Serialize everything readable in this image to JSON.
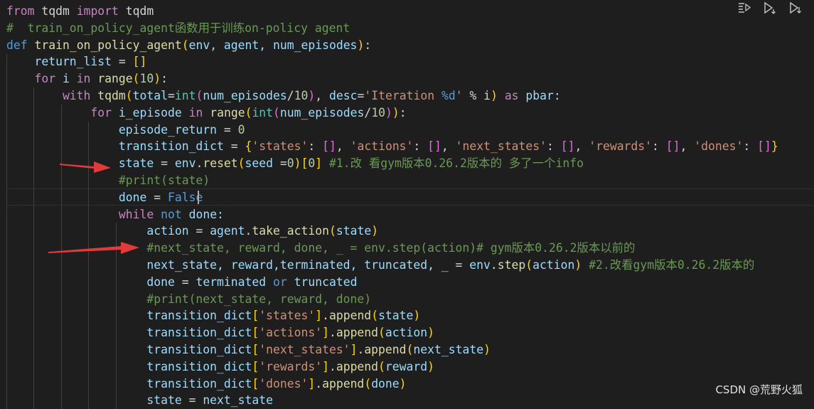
{
  "code_lines": [
    [
      {
        "t": "from",
        "c": "#c586c0"
      },
      {
        "t": " tqdm ",
        "c": "#d4d4d4"
      },
      {
        "t": "import",
        "c": "#c586c0"
      },
      {
        "t": " tqdm",
        "c": "#d4d4d4"
      }
    ],
    [
      {
        "t": "#  train_on_policy_agent函数用于训练on-policy agent",
        "c": "#6a9955"
      }
    ],
    [
      {
        "t": "def",
        "c": "#569cd6"
      },
      {
        "t": " ",
        "c": "#d4d4d4"
      },
      {
        "t": "train_on_policy_agent",
        "c": "#dcdcaa"
      },
      {
        "t": "(",
        "c": "#ffd700"
      },
      {
        "t": "env, agent, num_episodes",
        "c": "#9cdcfe"
      },
      {
        "t": ")",
        "c": "#ffd700"
      },
      {
        "t": ":",
        "c": "#d4d4d4"
      }
    ],
    [
      {
        "t": "    return_list",
        "c": "#9cdcfe"
      },
      {
        "t": " = ",
        "c": "#d4d4d4"
      },
      {
        "t": "[]",
        "c": "#ffd700"
      }
    ],
    [
      {
        "t": "    for",
        "c": "#c586c0"
      },
      {
        "t": " i ",
        "c": "#9cdcfe"
      },
      {
        "t": "in",
        "c": "#c586c0"
      },
      {
        "t": " ",
        "c": "#d4d4d4"
      },
      {
        "t": "range",
        "c": "#dcdcaa"
      },
      {
        "t": "(",
        "c": "#ffd700"
      },
      {
        "t": "10",
        "c": "#b5cea8"
      },
      {
        "t": ")",
        "c": "#ffd700"
      },
      {
        "t": ":",
        "c": "#d4d4d4"
      }
    ],
    [
      {
        "t": "        with",
        "c": "#c586c0"
      },
      {
        "t": " ",
        "c": "#d4d4d4"
      },
      {
        "t": "tqdm",
        "c": "#dcdcaa"
      },
      {
        "t": "(",
        "c": "#ffd700"
      },
      {
        "t": "total",
        "c": "#9cdcfe"
      },
      {
        "t": "=",
        "c": "#d4d4d4"
      },
      {
        "t": "int",
        "c": "#4ec9b0"
      },
      {
        "t": "(",
        "c": "#da70d6"
      },
      {
        "t": "num_episodes",
        "c": "#9cdcfe"
      },
      {
        "t": "/",
        "c": "#d4d4d4"
      },
      {
        "t": "10",
        "c": "#b5cea8"
      },
      {
        "t": ")",
        "c": "#da70d6"
      },
      {
        "t": ", ",
        "c": "#d4d4d4"
      },
      {
        "t": "desc",
        "c": "#9cdcfe"
      },
      {
        "t": "=",
        "c": "#d4d4d4"
      },
      {
        "t": "'Iteration ",
        "c": "#ce9178"
      },
      {
        "t": "%d",
        "c": "#569cd6"
      },
      {
        "t": "'",
        "c": "#ce9178"
      },
      {
        "t": " % i",
        "c": "#d4d4d4"
      },
      {
        "t": ")",
        "c": "#ffd700"
      },
      {
        "t": " ",
        "c": "#d4d4d4"
      },
      {
        "t": "as",
        "c": "#c586c0"
      },
      {
        "t": " pbar:",
        "c": "#9cdcfe"
      }
    ],
    [
      {
        "t": "            for",
        "c": "#c586c0"
      },
      {
        "t": " i_episode ",
        "c": "#9cdcfe"
      },
      {
        "t": "in",
        "c": "#c586c0"
      },
      {
        "t": " ",
        "c": "#d4d4d4"
      },
      {
        "t": "range",
        "c": "#dcdcaa"
      },
      {
        "t": "(",
        "c": "#ffd700"
      },
      {
        "t": "int",
        "c": "#4ec9b0"
      },
      {
        "t": "(",
        "c": "#da70d6"
      },
      {
        "t": "num_episodes",
        "c": "#9cdcfe"
      },
      {
        "t": "/",
        "c": "#d4d4d4"
      },
      {
        "t": "10",
        "c": "#b5cea8"
      },
      {
        "t": ")",
        "c": "#da70d6"
      },
      {
        "t": ")",
        "c": "#ffd700"
      },
      {
        "t": ":",
        "c": "#d4d4d4"
      }
    ],
    [
      {
        "t": "                episode_return",
        "c": "#9cdcfe"
      },
      {
        "t": " = ",
        "c": "#d4d4d4"
      },
      {
        "t": "0",
        "c": "#b5cea8"
      }
    ],
    [
      {
        "t": "                transition_dict",
        "c": "#9cdcfe"
      },
      {
        "t": " = ",
        "c": "#d4d4d4"
      },
      {
        "t": "{",
        "c": "#ffd700"
      },
      {
        "t": "'states'",
        "c": "#ce9178"
      },
      {
        "t": ": ",
        "c": "#d4d4d4"
      },
      {
        "t": "[]",
        "c": "#da70d6"
      },
      {
        "t": ", ",
        "c": "#d4d4d4"
      },
      {
        "t": "'actions'",
        "c": "#ce9178"
      },
      {
        "t": ": ",
        "c": "#d4d4d4"
      },
      {
        "t": "[]",
        "c": "#da70d6"
      },
      {
        "t": ", ",
        "c": "#d4d4d4"
      },
      {
        "t": "'next_states'",
        "c": "#ce9178"
      },
      {
        "t": ": ",
        "c": "#d4d4d4"
      },
      {
        "t": "[]",
        "c": "#da70d6"
      },
      {
        "t": ", ",
        "c": "#d4d4d4"
      },
      {
        "t": "'rewards'",
        "c": "#ce9178"
      },
      {
        "t": ": ",
        "c": "#d4d4d4"
      },
      {
        "t": "[]",
        "c": "#da70d6"
      },
      {
        "t": ", ",
        "c": "#d4d4d4"
      },
      {
        "t": "'dones'",
        "c": "#ce9178"
      },
      {
        "t": ": ",
        "c": "#d4d4d4"
      },
      {
        "t": "[]",
        "c": "#da70d6"
      },
      {
        "t": "}",
        "c": "#ffd700"
      }
    ],
    [
      {
        "t": "                state",
        "c": "#9cdcfe"
      },
      {
        "t": " = ",
        "c": "#d4d4d4"
      },
      {
        "t": "env",
        "c": "#9cdcfe"
      },
      {
        "t": ".",
        "c": "#d4d4d4"
      },
      {
        "t": "reset",
        "c": "#dcdcaa"
      },
      {
        "t": "(",
        "c": "#ffd700"
      },
      {
        "t": "seed",
        "c": "#9cdcfe"
      },
      {
        "t": " =",
        "c": "#d4d4d4"
      },
      {
        "t": "0",
        "c": "#b5cea8"
      },
      {
        "t": ")",
        "c": "#ffd700"
      },
      {
        "t": "[",
        "c": "#ffd700"
      },
      {
        "t": "0",
        "c": "#b5cea8"
      },
      {
        "t": "]",
        "c": "#ffd700"
      },
      {
        "t": " #1.改 看gym版本0.26.2版本的 多了一个info",
        "c": "#6a9955"
      }
    ],
    [
      {
        "t": "                #print(state)",
        "c": "#6a9955"
      }
    ],
    [
      {
        "t": "                done",
        "c": "#9cdcfe"
      },
      {
        "t": " = ",
        "c": "#d4d4d4"
      },
      {
        "t": "False",
        "c": "#569cd6"
      }
    ],
    [
      {
        "t": "                while",
        "c": "#c586c0"
      },
      {
        "t": " ",
        "c": "#d4d4d4"
      },
      {
        "t": "not",
        "c": "#569cd6"
      },
      {
        "t": " done:",
        "c": "#9cdcfe"
      }
    ],
    [
      {
        "t": "                    action",
        "c": "#9cdcfe"
      },
      {
        "t": " = ",
        "c": "#d4d4d4"
      },
      {
        "t": "agent",
        "c": "#9cdcfe"
      },
      {
        "t": ".",
        "c": "#d4d4d4"
      },
      {
        "t": "take_action",
        "c": "#dcdcaa"
      },
      {
        "t": "(",
        "c": "#ffd700"
      },
      {
        "t": "state",
        "c": "#9cdcfe"
      },
      {
        "t": ")",
        "c": "#ffd700"
      }
    ],
    [
      {
        "t": "                    #next_state, reward, done, _ = env.step(action)# gym版本0.26.2版本以前的",
        "c": "#6a9955"
      }
    ],
    [
      {
        "t": "                    next_state, reward,terminated, truncated, _",
        "c": "#9cdcfe"
      },
      {
        "t": " = ",
        "c": "#d4d4d4"
      },
      {
        "t": "env",
        "c": "#9cdcfe"
      },
      {
        "t": ".",
        "c": "#d4d4d4"
      },
      {
        "t": "step",
        "c": "#dcdcaa"
      },
      {
        "t": "(",
        "c": "#ffd700"
      },
      {
        "t": "action",
        "c": "#9cdcfe"
      },
      {
        "t": ")",
        "c": "#ffd700"
      },
      {
        "t": " #2.改看gym版本0.26.2版本的",
        "c": "#6a9955"
      }
    ],
    [
      {
        "t": "                    done",
        "c": "#9cdcfe"
      },
      {
        "t": " = ",
        "c": "#d4d4d4"
      },
      {
        "t": "terminated ",
        "c": "#9cdcfe"
      },
      {
        "t": "or",
        "c": "#569cd6"
      },
      {
        "t": " truncated",
        "c": "#9cdcfe"
      }
    ],
    [
      {
        "t": "                    #print(next_state, reward, done)",
        "c": "#6a9955"
      }
    ],
    [
      {
        "t": "                    transition_dict",
        "c": "#9cdcfe"
      },
      {
        "t": "[",
        "c": "#ffd700"
      },
      {
        "t": "'states'",
        "c": "#ce9178"
      },
      {
        "t": "]",
        "c": "#ffd700"
      },
      {
        "t": ".",
        "c": "#d4d4d4"
      },
      {
        "t": "append",
        "c": "#dcdcaa"
      },
      {
        "t": "(",
        "c": "#ffd700"
      },
      {
        "t": "state",
        "c": "#9cdcfe"
      },
      {
        "t": ")",
        "c": "#ffd700"
      }
    ],
    [
      {
        "t": "                    transition_dict",
        "c": "#9cdcfe"
      },
      {
        "t": "[",
        "c": "#ffd700"
      },
      {
        "t": "'actions'",
        "c": "#ce9178"
      },
      {
        "t": "]",
        "c": "#ffd700"
      },
      {
        "t": ".",
        "c": "#d4d4d4"
      },
      {
        "t": "append",
        "c": "#dcdcaa"
      },
      {
        "t": "(",
        "c": "#ffd700"
      },
      {
        "t": "action",
        "c": "#9cdcfe"
      },
      {
        "t": ")",
        "c": "#ffd700"
      }
    ],
    [
      {
        "t": "                    transition_dict",
        "c": "#9cdcfe"
      },
      {
        "t": "[",
        "c": "#ffd700"
      },
      {
        "t": "'next_states'",
        "c": "#ce9178"
      },
      {
        "t": "]",
        "c": "#ffd700"
      },
      {
        "t": ".",
        "c": "#d4d4d4"
      },
      {
        "t": "append",
        "c": "#dcdcaa"
      },
      {
        "t": "(",
        "c": "#ffd700"
      },
      {
        "t": "next_state",
        "c": "#9cdcfe"
      },
      {
        "t": ")",
        "c": "#ffd700"
      }
    ],
    [
      {
        "t": "                    transition_dict",
        "c": "#9cdcfe"
      },
      {
        "t": "[",
        "c": "#ffd700"
      },
      {
        "t": "'rewards'",
        "c": "#ce9178"
      },
      {
        "t": "]",
        "c": "#ffd700"
      },
      {
        "t": ".",
        "c": "#d4d4d4"
      },
      {
        "t": "append",
        "c": "#dcdcaa"
      },
      {
        "t": "(",
        "c": "#ffd700"
      },
      {
        "t": "reward",
        "c": "#9cdcfe"
      },
      {
        "t": ")",
        "c": "#ffd700"
      }
    ],
    [
      {
        "t": "                    transition_dict",
        "c": "#9cdcfe"
      },
      {
        "t": "[",
        "c": "#ffd700"
      },
      {
        "t": "'dones'",
        "c": "#ce9178"
      },
      {
        "t": "]",
        "c": "#ffd700"
      },
      {
        "t": ".",
        "c": "#d4d4d4"
      },
      {
        "t": "append",
        "c": "#dcdcaa"
      },
      {
        "t": "(",
        "c": "#ffd700"
      },
      {
        "t": "done",
        "c": "#9cdcfe"
      },
      {
        "t": ")",
        "c": "#ffd700"
      }
    ],
    [
      {
        "t": "                    state",
        "c": "#9cdcfe"
      },
      {
        "t": " = ",
        "c": "#d4d4d4"
      },
      {
        "t": "next_state",
        "c": "#9cdcfe"
      }
    ]
  ],
  "toolbar": {
    "icons": [
      "run-by-line-icon",
      "execute-cell-icon",
      "execute-below-icon"
    ]
  },
  "annotation_color": "#e03a3a",
  "watermark": "CSDN @荒野火狐"
}
